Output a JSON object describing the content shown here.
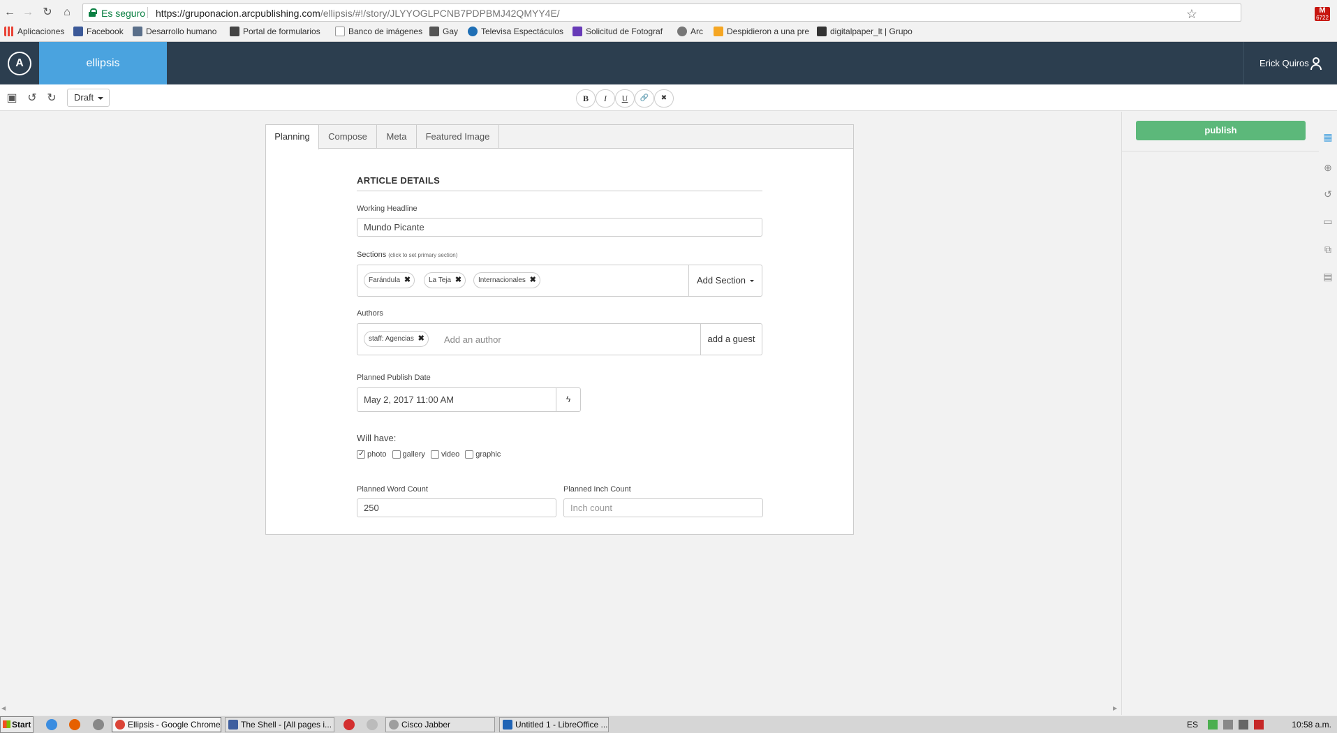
{
  "browser": {
    "secure_label": "Es seguro",
    "url_host": "https://gruponacion.arcpublishing.com",
    "url_path": "/ellipsis/#!/story/JLYYOGLPCNB7PDPBMJ42QMYY4E/",
    "gmail_count": "6722",
    "bookmarks": [
      {
        "label": "Aplicaciones",
        "color": "#e94235"
      },
      {
        "label": "Facebook",
        "color": "#3b5998"
      },
      {
        "label": "Desarrollo humano",
        "color": "#5a6f8a"
      },
      {
        "label": "Portal de formularios",
        "color": "#444444"
      },
      {
        "label": "Banco de imágenes",
        "color": "#9e9e9e"
      },
      {
        "label": "Gay",
        "color": "#555555"
      },
      {
        "label": "Televisa Espectáculos",
        "color": "#1f6fb5"
      },
      {
        "label": "Solicitud de Fotograf",
        "color": "#673ab7"
      },
      {
        "label": "Arc",
        "color": "#777777"
      },
      {
        "label": "Despidieron a una pre",
        "color": "#f5a623"
      },
      {
        "label": "digitalpaper_lt | Grupo",
        "color": "#333333"
      }
    ]
  },
  "app": {
    "logo": "A",
    "name": "ellipsis",
    "user_name": "Erick Quiros",
    "accent": "#4aa3df",
    "header_bg": "#2c3e4f"
  },
  "toolbar": {
    "status": "Draft",
    "format_buttons": [
      "B",
      "I",
      "U",
      "🔗",
      "✖"
    ]
  },
  "right_panel": {
    "publish_label": "publish",
    "publish_color": "#5cb87a",
    "side_icons": [
      "calendar-icon",
      "plus-circle-icon",
      "history-icon",
      "inbox-icon",
      "copy-icon",
      "clipboard-icon"
    ]
  },
  "tabs": [
    "Planning",
    "Compose",
    "Meta",
    "Featured Image"
  ],
  "article": {
    "section_title": "ARTICLE DETAILS",
    "headline_label": "Working Headline",
    "headline_value": "Mundo Picante",
    "sections_label": "Sections",
    "sections_hint": "(click to set primary section)",
    "sections": [
      "Farándula",
      "La Teja",
      "Internacionales"
    ],
    "add_section": "Add Section",
    "authors_label": "Authors",
    "authors": [
      "staff: Agencias"
    ],
    "author_placeholder": "Add an author",
    "add_guest": "add a guest",
    "publish_date_label": "Planned Publish Date",
    "publish_date_value": "May 2, 2017 11:00 AM",
    "will_have_label": "Will have:",
    "will_have": [
      {
        "label": "photo",
        "checked": true
      },
      {
        "label": "gallery",
        "checked": false
      },
      {
        "label": "video",
        "checked": false
      },
      {
        "label": "graphic",
        "checked": false
      }
    ],
    "word_count_label": "Planned Word Count",
    "word_count_value": "250",
    "inch_count_label": "Planned Inch Count",
    "inch_count_placeholder": "Inch count"
  },
  "taskbar": {
    "start": "Start",
    "windows": [
      "Ellipsis - Google Chrome",
      "The Shell - [All pages i...",
      "Cisco Jabber",
      "Untitled 1 - LibreOffice ..."
    ],
    "lang": "ES",
    "clock": "10:58 a.m."
  }
}
